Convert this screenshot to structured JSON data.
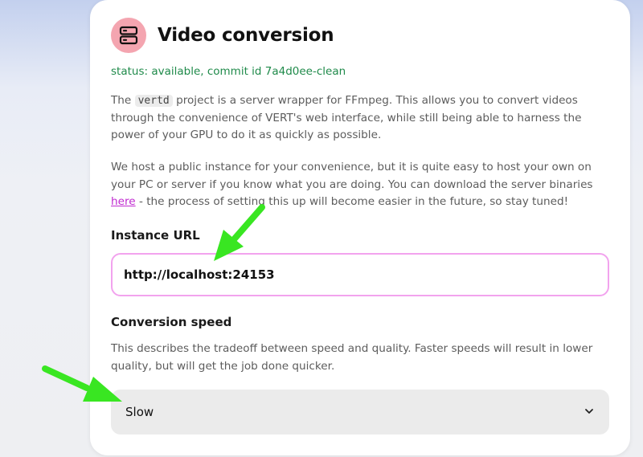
{
  "card": {
    "title": "Video conversion",
    "title_icon": "server-icon",
    "status": "status: available, commit id 7a4d0ee-clean",
    "desc1": {
      "before": "The ",
      "code": "vertd",
      "after": " project is a server wrapper for FFmpeg. This allows you to convert videos through the convenience of VERT's web interface, while still being able to harness the power of your GPU to do it as quickly as possible."
    },
    "desc2": {
      "before": "We host a public instance for your convenience, but it is quite easy to host your own on your PC or server if you know what you are doing. You can download the server binaries ",
      "link": "here",
      "after": " - the process of setting this up will become easier in the future, so stay tuned!"
    },
    "instance_label": "Instance URL",
    "instance_value": "http://localhost:24153",
    "speed_label": "Conversion speed",
    "speed_desc": "This describes the tradeoff between speed and quality. Faster speeds will result in lower quality, but will get the job done quicker.",
    "speed_value": "Slow"
  },
  "colors": {
    "status": "#1f8a4a",
    "link": "#c02bd0",
    "icon_bg": "#f4a5b0",
    "input_border": "#f2a3ee",
    "annotation_arrow": "#39e622"
  }
}
